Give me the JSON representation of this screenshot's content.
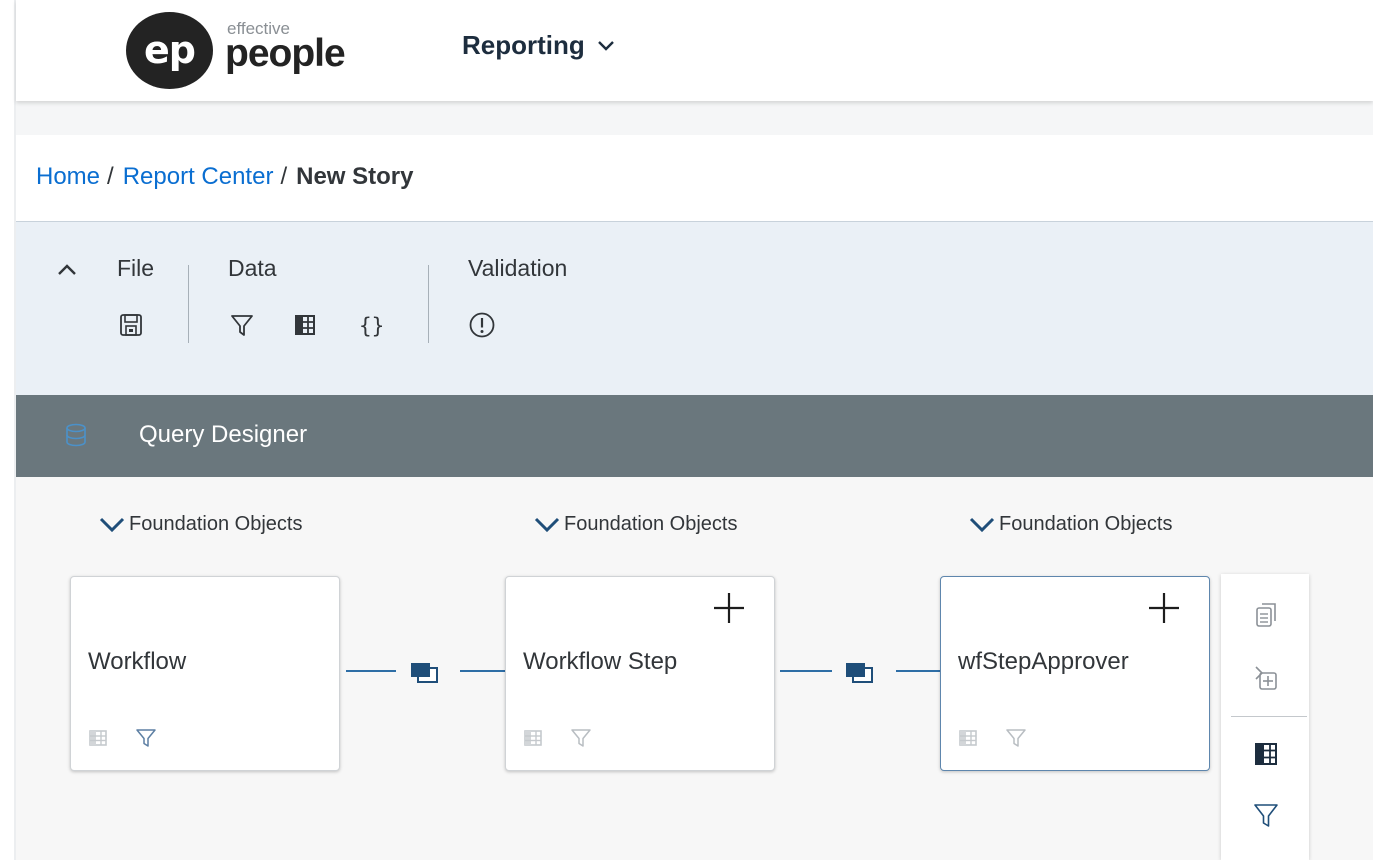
{
  "header": {
    "logo_mark": "ep",
    "logo_small": "effective",
    "logo_big": "people",
    "menu_title": "Reporting"
  },
  "breadcrumb": {
    "items": [
      "Home",
      "Report Center"
    ],
    "separator": "/",
    "current": "New Story"
  },
  "toolbar": {
    "groups": [
      {
        "label": "File",
        "icons": [
          "save-icon"
        ]
      },
      {
        "label": "Data",
        "icons": [
          "filter-icon",
          "table-icon",
          "braces-icon"
        ]
      },
      {
        "label": "Validation",
        "icons": [
          "exclamation-circle-icon"
        ]
      }
    ]
  },
  "query_designer": {
    "title": "Query Designer",
    "nodes": [
      {
        "group_label": "Foundation Objects",
        "name": "Workflow",
        "has_add": false,
        "selected": false
      },
      {
        "group_label": "Foundation Objects",
        "name": "Workflow Step",
        "has_add": true,
        "selected": false
      },
      {
        "group_label": "Foundation Objects",
        "name": "wfStepApprover",
        "has_add": true,
        "selected": true
      }
    ],
    "side_panel_icons": [
      "copy-icon",
      "add-join-icon",
      "columns-icon",
      "filter-icon"
    ]
  },
  "colors": {
    "link": "#0a6ed1",
    "toolbar_bg": "#eaf0f6",
    "query_bar": "#6a777d",
    "connector": "#2e6ea6"
  }
}
